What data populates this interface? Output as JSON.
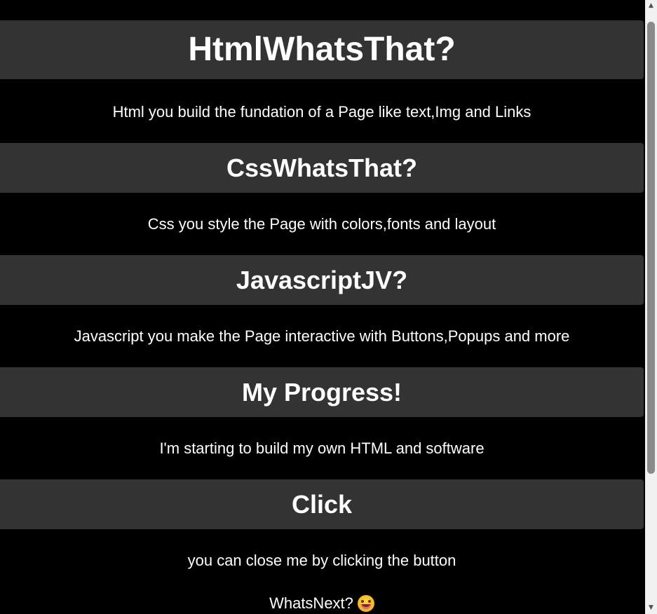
{
  "sections": [
    {
      "heading": "HtmlWhatsThat?",
      "text": "Html you build the fundation of a Page like text,Img and Links"
    },
    {
      "heading": "CssWhatsThat?",
      "text": "Css you style the Page with colors,fonts and layout"
    },
    {
      "heading": "JavascriptJV?",
      "text": "Javascript you make the Page interactive with Buttons,Popups and more"
    },
    {
      "heading": "My Progress!",
      "text": "I'm starting to build my own HTML and software"
    },
    {
      "heading": "Click",
      "text": "you can close me by clicking the button"
    }
  ],
  "footer": {
    "text": "WhatsNext?",
    "emoji_icon": "grinning-face-with-tongue-icon"
  },
  "scrollbar": {
    "up_arrow": "▲",
    "down_arrow": "▼"
  },
  "colors": {
    "background": "#000000",
    "header_background": "#333333",
    "text": "#ffffff"
  }
}
